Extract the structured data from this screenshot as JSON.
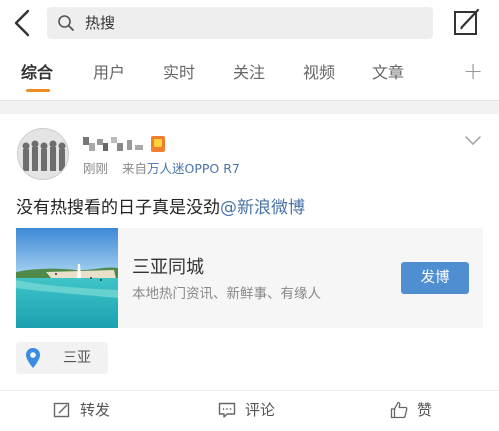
{
  "header": {
    "search_value": "热搜"
  },
  "tabs": [
    {
      "label": "综合"
    },
    {
      "label": "用户"
    },
    {
      "label": "实时"
    },
    {
      "label": "关注"
    },
    {
      "label": "视频"
    },
    {
      "label": "文章"
    }
  ],
  "tabs_plus": "+",
  "post": {
    "time": "刚刚",
    "source_prefix": "来自",
    "source_name": "万人迷OPPO R7",
    "text_main": "没有热搜看的日子真是没劲",
    "text_mention": "@新浪微博"
  },
  "location_card": {
    "title": "三亚同城",
    "subtitle": "本地热门资讯、新鲜事、有缘人",
    "button_label": "发博"
  },
  "location_tag": {
    "label": "三亚"
  },
  "actions": {
    "repost": "转发",
    "comment": "评论",
    "like": "赞"
  },
  "colors": {
    "accent_orange": "#f08a24",
    "link_blue": "#4a73a8",
    "button_blue": "#4f8fd1",
    "pin_blue": "#3c8de0"
  }
}
